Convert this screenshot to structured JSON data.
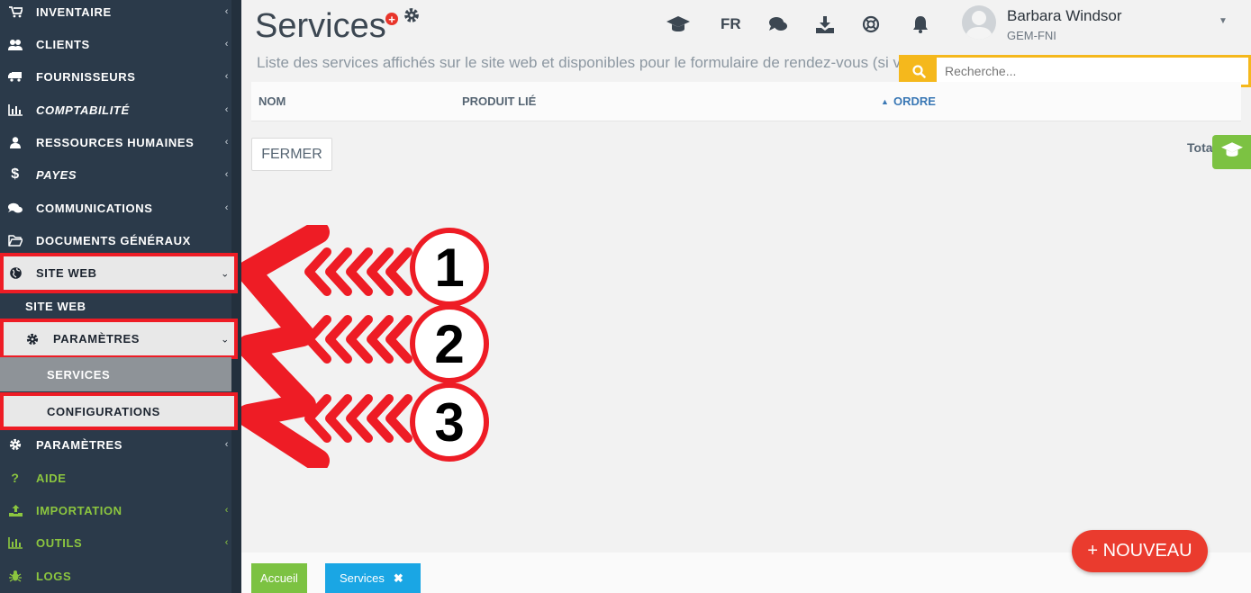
{
  "sidebar": {
    "items": [
      {
        "label": "INVENTAIRE",
        "icon": "cart-icon"
      },
      {
        "label": "CLIENTS",
        "icon": "users-icon"
      },
      {
        "label": "FOURNISSEURS",
        "icon": "truck-icon"
      },
      {
        "label": "COMPTABILITÉ",
        "icon": "bar-chart-icon"
      },
      {
        "label": "RESSOURCES HUMAINES",
        "icon": "user-icon"
      },
      {
        "label": "PAYES",
        "icon": "dollar-icon"
      },
      {
        "label": "COMMUNICATIONS",
        "icon": "comments-icon"
      },
      {
        "label": "DOCUMENTS GÉNÉRAUX",
        "icon": "folder-open-icon"
      },
      {
        "label": "SITE WEB",
        "icon": "globe-icon"
      },
      {
        "label": "SITE WEB"
      },
      {
        "label": "PARAMÈTRES",
        "icon": "gear-icon"
      },
      {
        "label": "SERVICES"
      },
      {
        "label": "CONFIGURATIONS"
      },
      {
        "label": "PARAMÈTRES",
        "icon": "gear-icon"
      },
      {
        "label": "AIDE",
        "icon": "question-icon"
      },
      {
        "label": "IMPORTATION",
        "icon": "upload-icon"
      },
      {
        "label": "OUTILS",
        "icon": "bar-chart-icon"
      },
      {
        "label": "LOGS",
        "icon": "bug-icon"
      }
    ]
  },
  "header": {
    "title": "Services",
    "subtitle": "Liste des services affichés sur le site web et disponibles pour le formulaire de rendez-vous (si v",
    "lang": "FR",
    "user_name": "Barbara Windsor",
    "user_org": "GEM-FNI"
  },
  "search": {
    "placeholder": "Recherche..."
  },
  "table": {
    "columns": [
      "NOM",
      "PRODUIT LIÉ",
      "ORDRE"
    ],
    "sort_indicator": "▲"
  },
  "actions": {
    "close_label": "FERMER",
    "total_label": "Tota",
    "new_label": "+ NOUVEAU"
  },
  "tabs": [
    {
      "label": "Accueil"
    },
    {
      "label": "Services",
      "close": "✖"
    }
  ],
  "annotations": [
    "1",
    "2",
    "3"
  ],
  "colors": {
    "sidebar_bg": "#2b3a4a",
    "highlight_red": "#ee1c25",
    "accent_green": "#7cc242",
    "accent_blue": "#1aa6e4",
    "search_yellow": "#f5b81c",
    "new_button": "#ea3b2e"
  }
}
